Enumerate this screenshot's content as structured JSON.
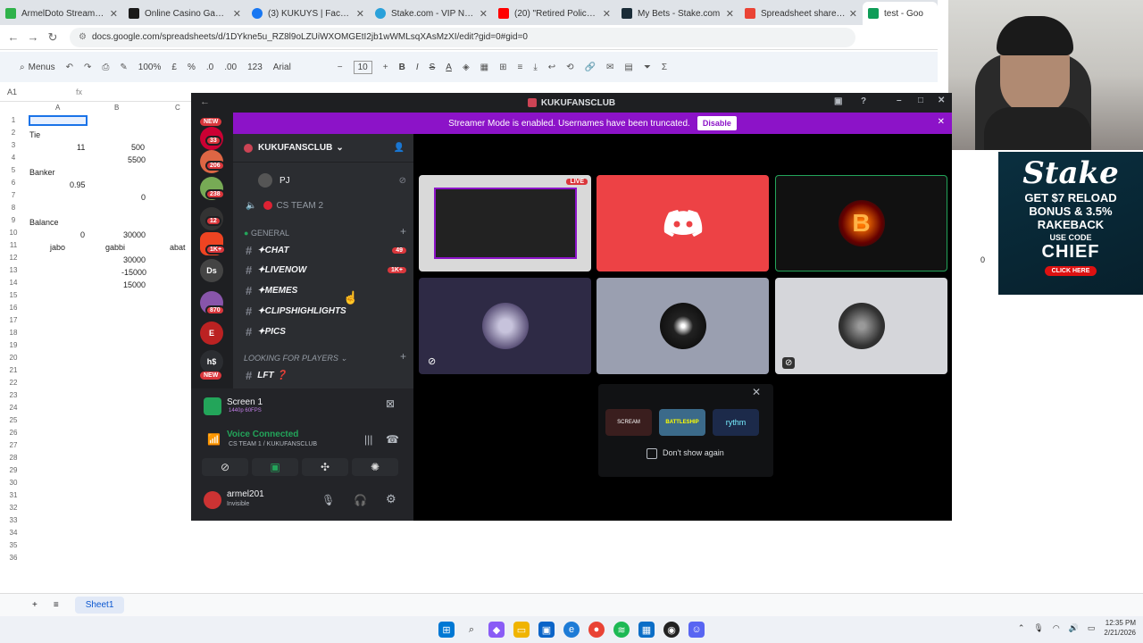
{
  "browser": {
    "tabs": [
      {
        "title": "ArmelDoto Stream - Watc",
        "color": "#2fb24a"
      },
      {
        "title": "Online Casino Games - Pl",
        "color": "#1a1a1a"
      },
      {
        "title": "(3) KUKUYS | Facebook",
        "color": "#1877f2"
      },
      {
        "title": "Stake.com - VIP Notices",
        "color": "#2aa1da"
      },
      {
        "title": "(20) \"Retired Police Ako\"",
        "color": "#ff0000"
      },
      {
        "title": "My Bets - Stake.com",
        "color": "#1a2c38"
      },
      {
        "title": "Spreadsheet shared with",
        "color": "#ea4335"
      },
      {
        "title": "test - Goo",
        "color": "#0f9d58"
      }
    ],
    "url": "docs.google.com/spreadsheets/d/1DYkne5u_RZ8l9oLZUiWXOMGEtI2jb1wWMLsqXAsMzXI/edit?gid=0#gid=0"
  },
  "sheets": {
    "menus_label": "Menus",
    "zoom": "100%",
    "currency": "£",
    "percent": "%",
    "dec_dec": ".0",
    "dec_inc": ".00",
    "num_format": "123",
    "font": "Arial",
    "font_size": "10",
    "cell_ref": "A1",
    "columns": [
      "A",
      "B",
      "C"
    ],
    "rows": [
      "1",
      "2",
      "3",
      "4",
      "5",
      "6",
      "7",
      "8",
      "9",
      "10",
      "11",
      "12",
      "13",
      "14",
      "15",
      "16",
      "17",
      "18",
      "19",
      "20",
      "21",
      "22",
      "23",
      "24",
      "25",
      "26",
      "27",
      "28",
      "29",
      "30",
      "31",
      "32",
      "33",
      "34",
      "35",
      "36"
    ],
    "cells": {
      "tie": "Tie",
      "v11": "11",
      "v500": "500",
      "v5500": "5500",
      "banker": "Banker",
      "v095": "0.95",
      "v0a": "0",
      "balance": "Balance",
      "v0b": "0",
      "v30000a": "30000",
      "jabo": "jabo",
      "gabbi": "gabbi",
      "abat": "abat",
      "v30000b": "30000",
      "vneg15000": "-15000",
      "v15000": "15000",
      "right0": "0"
    },
    "sheet_tab": "Sheet1"
  },
  "discord": {
    "window_title": "KUKUFANSCLUB",
    "streamer_banner": "Streamer Mode is enabled. Usernames have been truncated.",
    "disable_label": "Disable",
    "server_name": "KUKUFANSCLUB",
    "guild_badges": [
      "33",
      "206",
      "238",
      "12",
      "1K+",
      "870"
    ],
    "new_label": "NEW",
    "guild_letters": [
      "Ds",
      "E",
      "h$"
    ],
    "voice_user": "PJ",
    "voice_channel": "CS TEAM 2",
    "category_general": "GENERAL",
    "channels": [
      {
        "name": "✦CHAT",
        "count": "49"
      },
      {
        "name": "✦LIVENOW",
        "count": "1K+"
      },
      {
        "name": "✦MEMES",
        "count": ""
      },
      {
        "name": "✦CLIPSHIGHLIGHTS",
        "count": ""
      },
      {
        "name": "✦PICS",
        "count": ""
      }
    ],
    "category_lfp": "LOOKING FOR PLAYERS",
    "channel_lft": "LFT ❓",
    "screen_label": "Screen 1",
    "screen_sub": "1440p 60FPS",
    "voice_connected": "Voice Connected",
    "voice_location": "CS TEAM 1 / KUKUFANSCLUB",
    "username": "armel201",
    "status": "Invisible",
    "live_label": "LIVE",
    "dont_show": "Don't show again",
    "activity_labels": [
      "SCREAM",
      "BATTLESHIP",
      "rythm"
    ]
  },
  "stake_ad": {
    "logo": "Stake",
    "line1": "GET $7 RELOAD",
    "line2": "BONUS & 3.5%",
    "line3": "RAKEBACK",
    "use_code": "USE CODE",
    "code": "CHIEF",
    "cta": "CLICK HERE"
  },
  "taskbar": {
    "time": "12:35 PM",
    "date": "2/21/2026"
  }
}
